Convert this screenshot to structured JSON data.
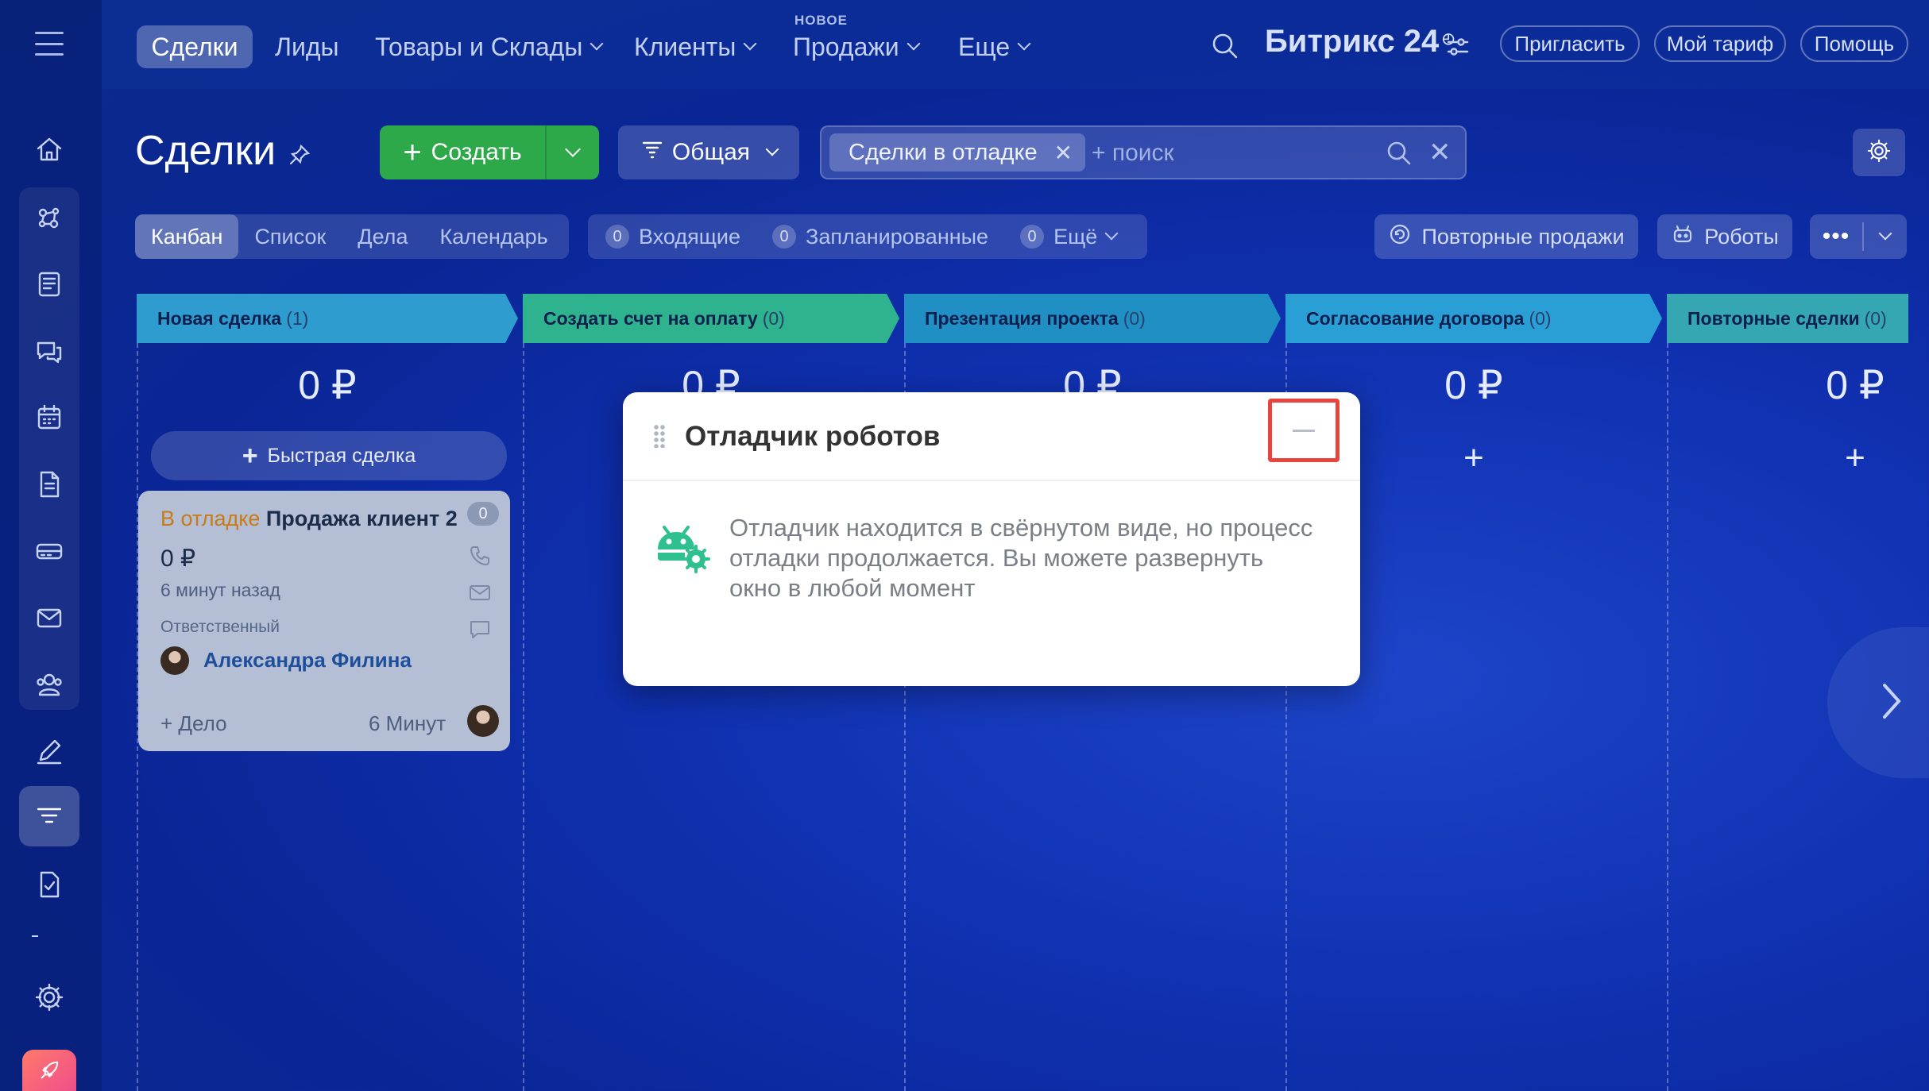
{
  "nav": {
    "items": [
      {
        "label": "Сделки"
      },
      {
        "label": "Лиды"
      },
      {
        "label": "Товары и Склады"
      },
      {
        "label": "Клиенты"
      },
      {
        "label": "Продажи"
      },
      {
        "label": "Еще"
      }
    ],
    "new_badge": "НОВОЕ",
    "brand": "Битрикс 24",
    "invite": "Пригласить",
    "tariff": "Мой тариф",
    "help": "Помощь"
  },
  "toolbar": {
    "title": "Сделки",
    "create": "Создать",
    "preset": "Общая",
    "filter_chip": "Сделки в отладке",
    "search_placeholder": "+ поиск"
  },
  "views": {
    "tabs": [
      {
        "label": "Канбан",
        "active": true
      },
      {
        "label": "Список"
      },
      {
        "label": "Дела"
      },
      {
        "label": "Календарь"
      }
    ],
    "counters": [
      {
        "count": "0",
        "label": "Входящие"
      },
      {
        "count": "0",
        "label": "Запланированные"
      },
      {
        "count": "0",
        "label": "Ещё"
      }
    ],
    "repeat_sales": "Повторные продажи",
    "robots": "Роботы",
    "more": "•••"
  },
  "stages": [
    {
      "name": "Новая сделка",
      "count": "(1)",
      "sum": "0 ₽",
      "color": "#2f9cd0"
    },
    {
      "name": "Создать счет на оплату",
      "count": "(0)",
      "sum": "0 ₽",
      "color": "#2eb38e"
    },
    {
      "name": "Презентация проекта",
      "count": "(0)",
      "sum": "0 ₽",
      "color": "#1f8fc4"
    },
    {
      "name": "Согласование договора",
      "count": "(0)",
      "sum": "0 ₽",
      "color": "#2a9fd6"
    },
    {
      "name": "Повторные сделки",
      "count": "(0)",
      "sum": "0 ₽",
      "color": "#35a7b3"
    }
  ],
  "kanban": {
    "quick_deal": "Быстрая сделка",
    "add_symbol": "+"
  },
  "deal": {
    "debug_tag": "В отладке",
    "title": "Продажа клиент 2",
    "count": "0",
    "sum": "0 ₽",
    "ago": "6 минут назад",
    "responsible_label": "Ответственный",
    "responsible": "Александра Филина",
    "add_activity": "+ Дело",
    "time": "6 Минут"
  },
  "debugger": {
    "title": "Отладчик роботов",
    "text": "Отладчик находится в свёрнутом виде, но процесс отладки продолжается. Вы можете развернуть окно в любой момент"
  }
}
